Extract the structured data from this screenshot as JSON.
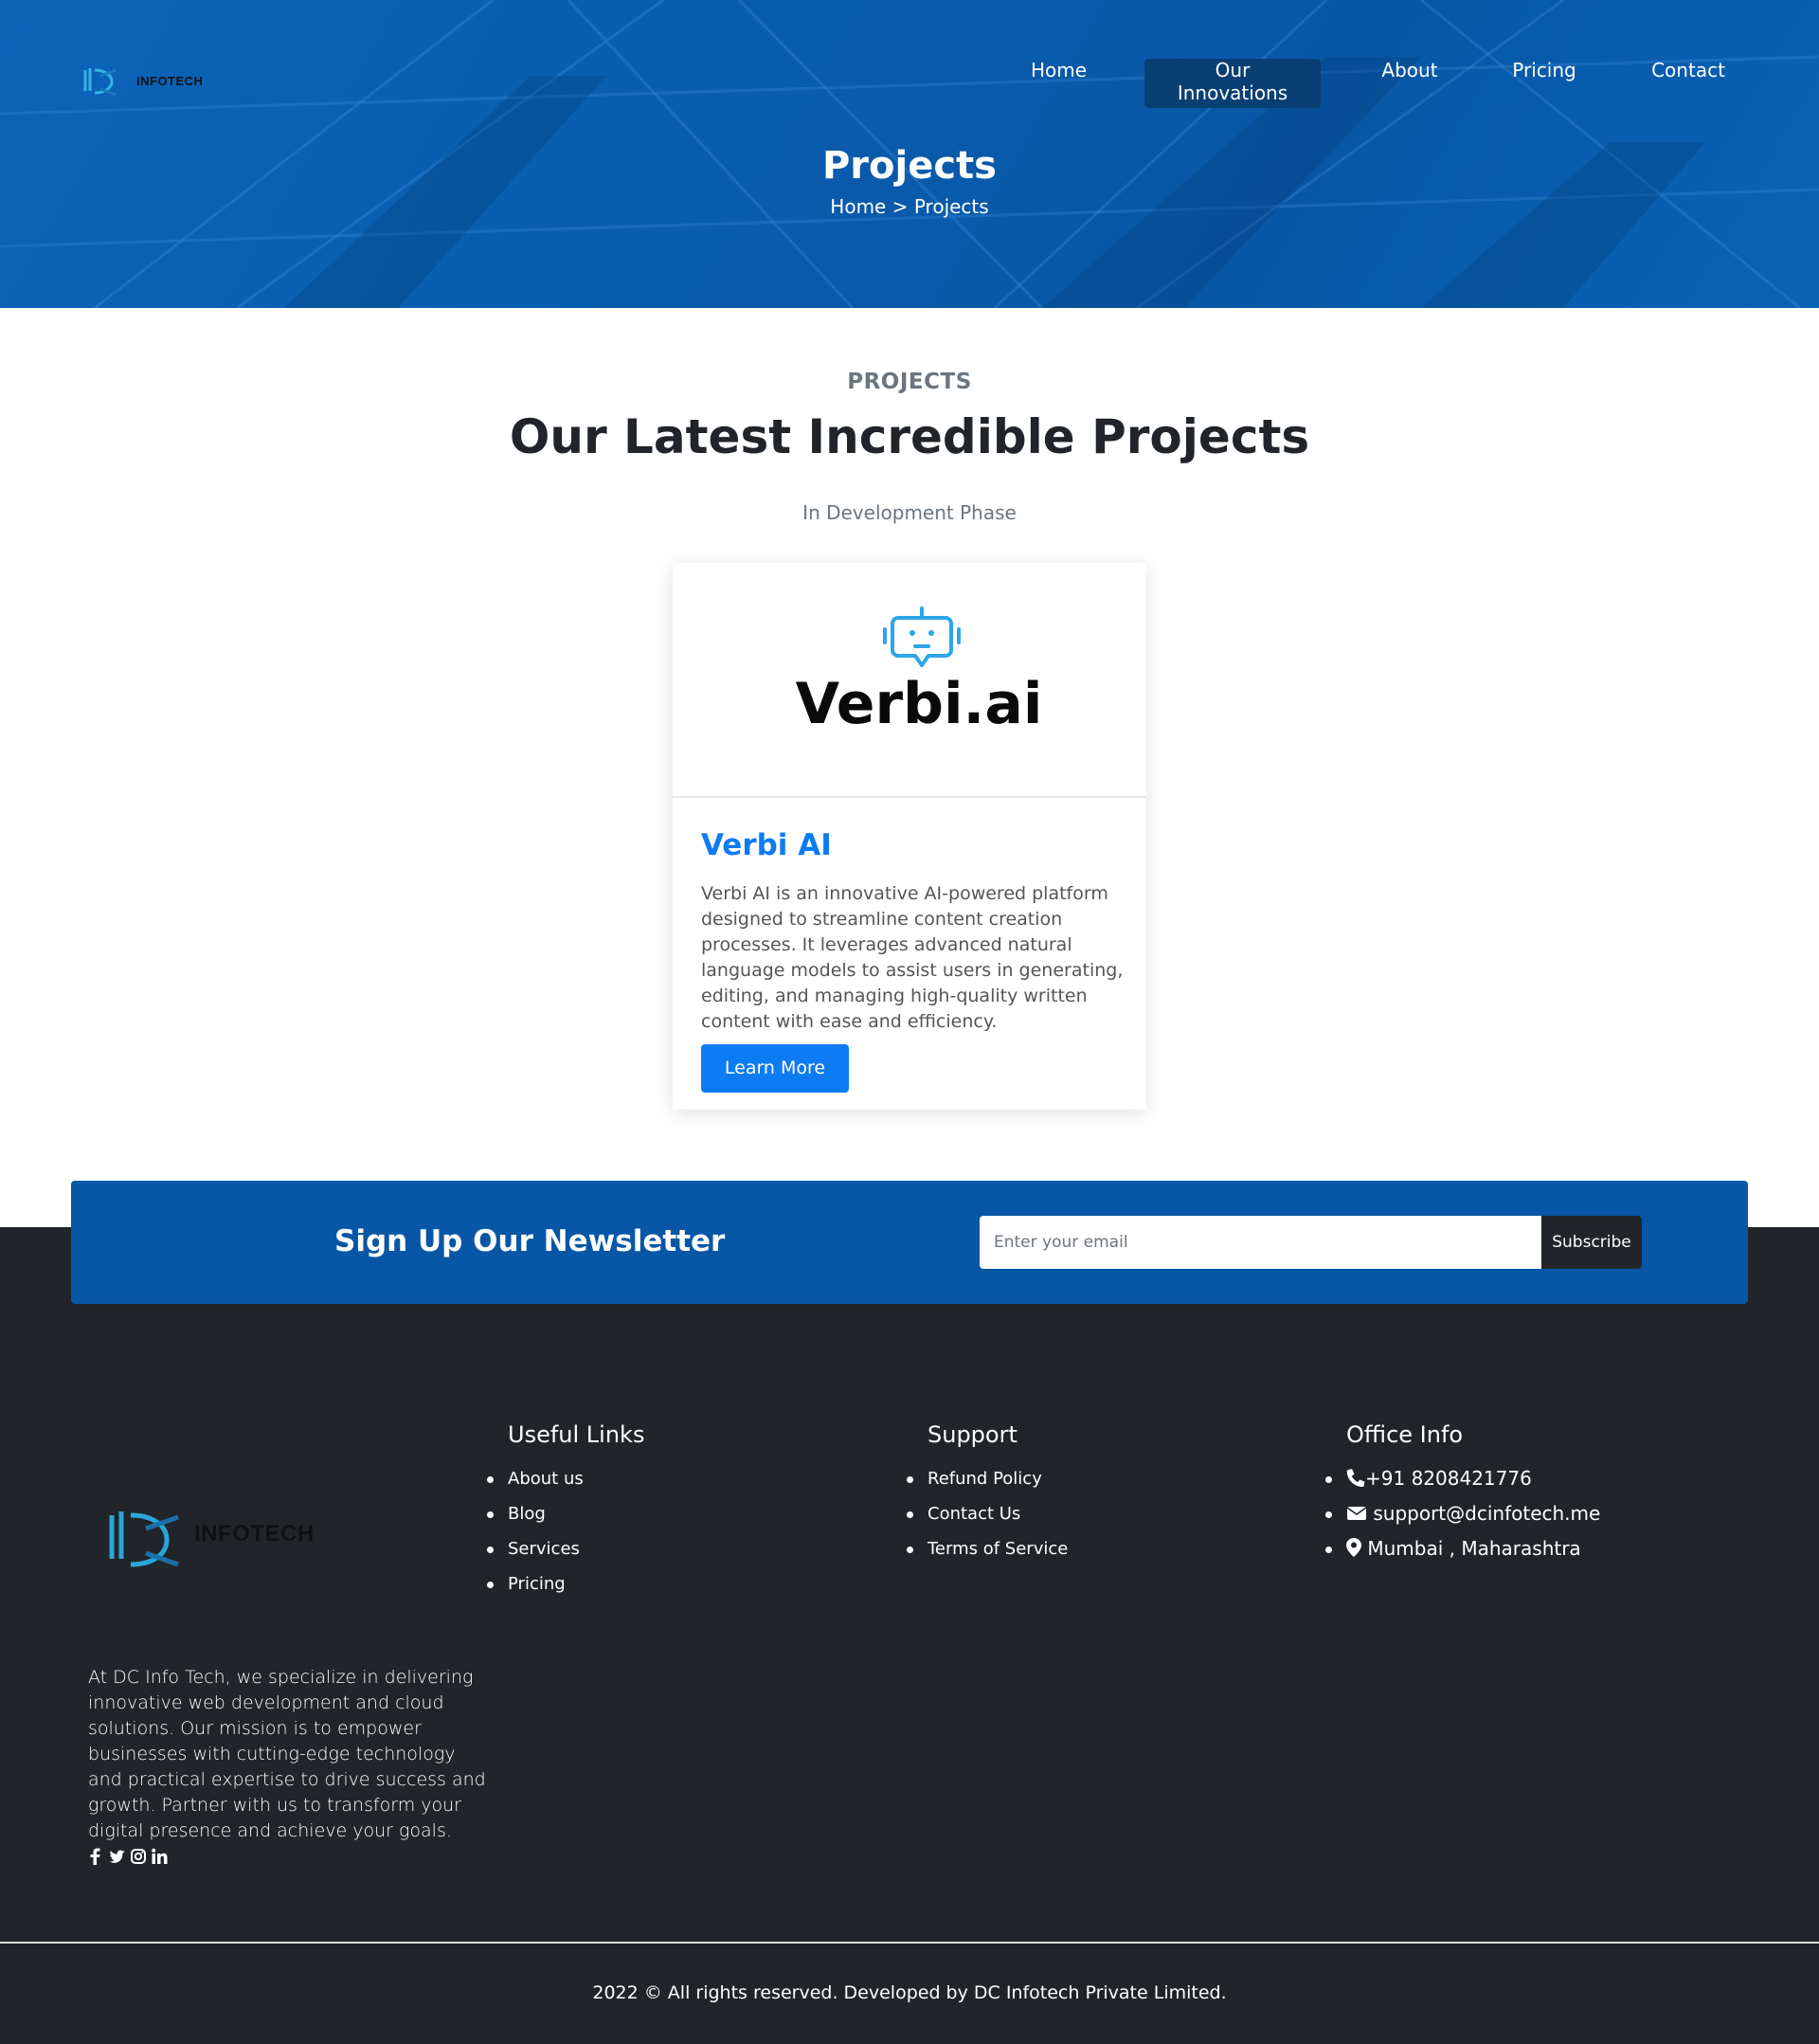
{
  "header": {
    "logo_text": "INFOTECH",
    "nav": [
      {
        "label": "Home"
      },
      {
        "label": "Our Innovations",
        "active": true
      },
      {
        "label": "About"
      },
      {
        "label": "Pricing"
      },
      {
        "label": "Contact"
      }
    ],
    "page_title": "Projects",
    "breadcrumb": {
      "home": "Home",
      "separator": " > ",
      "current": "Projects"
    }
  },
  "projects": {
    "eyebrow": "PROJECTS",
    "title": "Our Latest Incredible Projects",
    "phase": "In Development Phase",
    "card": {
      "image_brand": "Verbi.ai",
      "image_icon": "robot-chat-icon",
      "title": "Verbi AI",
      "description": "Verbi AI is an innovative AI-powered platform designed to streamline content creation processes. It leverages advanced natural language models to assist users in generating, editing, and managing high-quality written content with ease and efficiency.",
      "button_label": "Learn More"
    }
  },
  "newsletter": {
    "title": "Sign Up Our Newsletter",
    "placeholder": "Enter your email",
    "button_label": "Subscribe"
  },
  "footer": {
    "logo_text": "INFOTECH",
    "about": "At DC Info Tech, we specialize in delivering innovative web development and cloud solutions. Our mission is to empower businesses with cutting-edge technology and practical expertise to drive success and growth. Partner with us to transform your digital presence and achieve your goals.",
    "socials": [
      "facebook-icon",
      "twitter-icon",
      "instagram-icon",
      "linkedin-icon"
    ],
    "useful_links": {
      "heading": "Useful Links",
      "items": [
        "About us",
        "Blog",
        "Services",
        "Pricing"
      ]
    },
    "support": {
      "heading": "Support",
      "items": [
        "Refund Policy",
        "Contact Us",
        "Terms of Service"
      ]
    },
    "office": {
      "heading": "Office Info",
      "phone": "+91 8208421776",
      "email": "support@dcinfotech.me",
      "location": "Mumbai , Maharashtra"
    },
    "copyright": "2022 © All rights reserved. Developed by DC Infotech Private Limited."
  },
  "colors": {
    "hero_blue": "#0a5cad",
    "active_nav": "#0a3f73",
    "accent": "#0d7bf2",
    "newsletter_bg": "#0857a6",
    "footer_bg": "#212529"
  }
}
